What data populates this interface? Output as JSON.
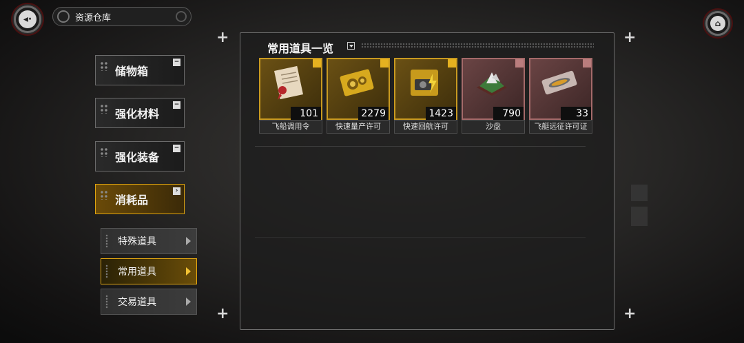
{
  "header": {
    "back_icon": "back-arrow-icon",
    "title": "资源仓库",
    "home_icon": "home-icon"
  },
  "categories": [
    {
      "label": "储物箱",
      "active": false,
      "mark": "−"
    },
    {
      "label": "强化材料",
      "active": false,
      "mark": "−"
    },
    {
      "label": "强化装备",
      "active": false,
      "mark": "−"
    },
    {
      "label": "消耗品",
      "active": true,
      "mark": "›"
    }
  ],
  "subcategories": [
    {
      "label": "特殊道具",
      "active": false
    },
    {
      "label": "常用道具",
      "active": true
    },
    {
      "label": "交易道具",
      "active": false
    }
  ],
  "panel": {
    "title": "常用道具一览"
  },
  "items": [
    {
      "name": "飞船调用令",
      "count": "101",
      "rarity": "gold",
      "icon": "document-scroll-icon"
    },
    {
      "name": "快速量产许可",
      "count": "2279",
      "rarity": "gold",
      "icon": "gear-ticket-icon"
    },
    {
      "name": "快速回航许可",
      "count": "1423",
      "rarity": "gold",
      "icon": "camera-bolt-ticket-icon"
    },
    {
      "name": "沙盘",
      "count": "790",
      "rarity": "red",
      "icon": "sand-table-icon"
    },
    {
      "name": "飞艇远征许可证",
      "count": "33",
      "rarity": "red",
      "icon": "airship-ticket-icon"
    }
  ],
  "colors": {
    "accent_gold": "#e0a510",
    "rare_red": "#a56a6a"
  }
}
